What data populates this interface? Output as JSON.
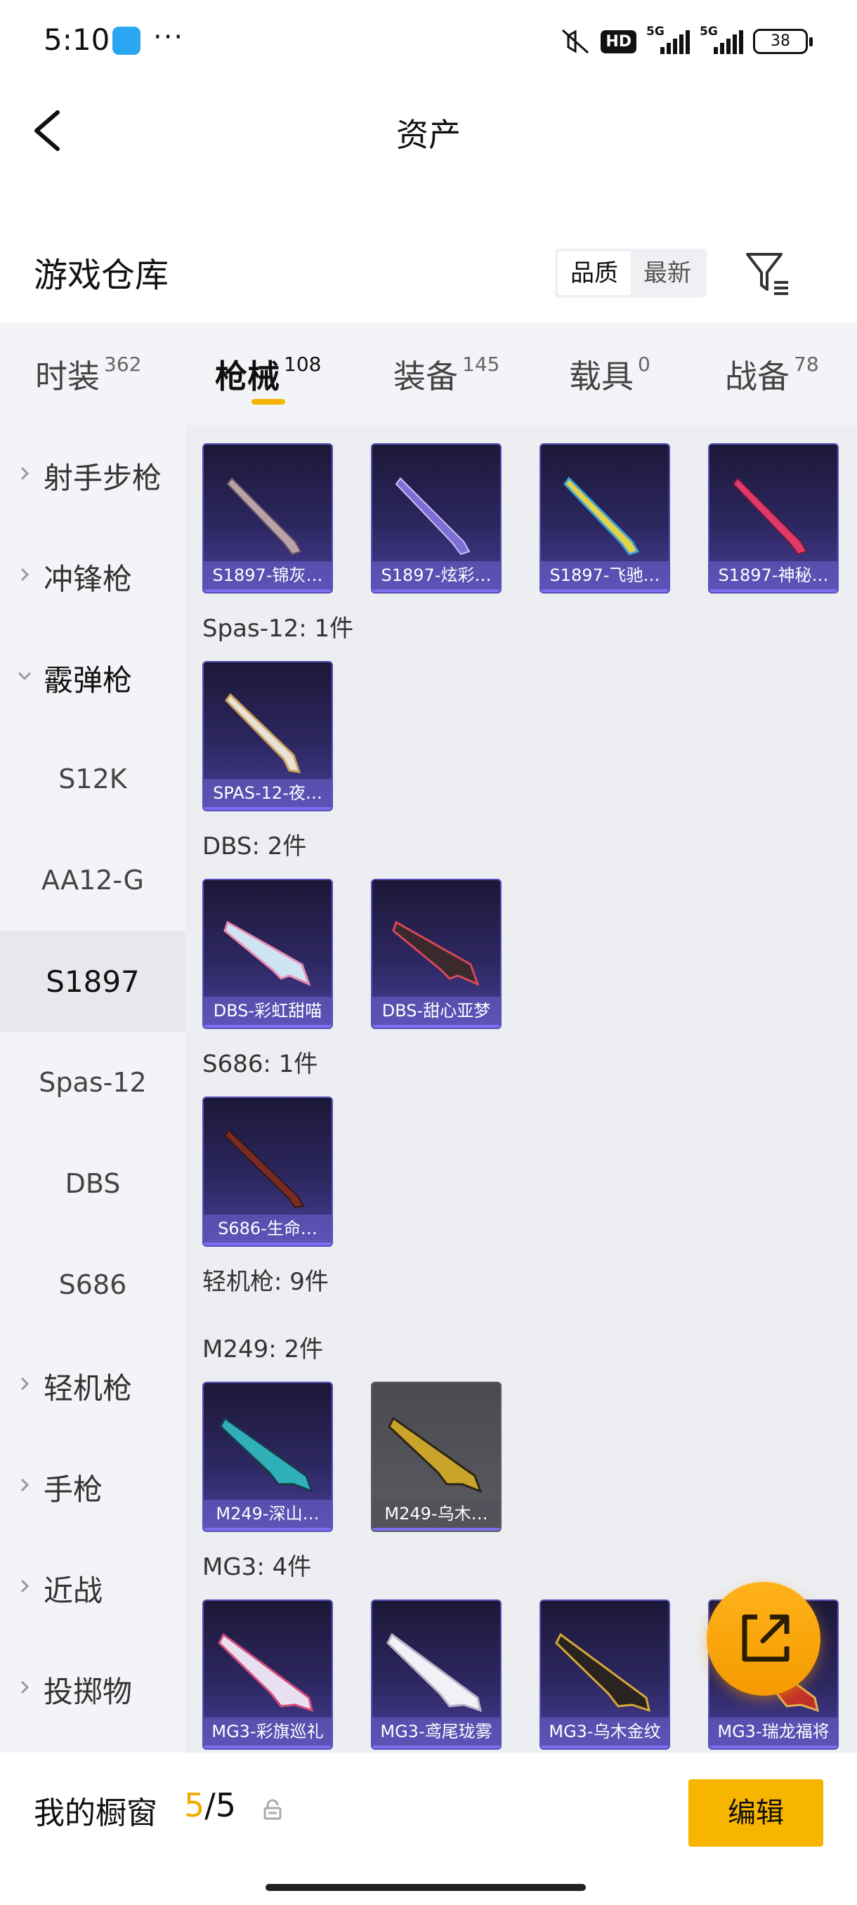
{
  "status_bar": {
    "time": "5:10",
    "more": "···",
    "hd": "HD",
    "net1": "5G",
    "net2": "5G",
    "battery": "38"
  },
  "header": {
    "title": "资产"
  },
  "section": {
    "title": "游戏仓库",
    "sort_quality": "品质",
    "sort_newest": "最新"
  },
  "tabs": [
    {
      "label": "时装",
      "count": "362"
    },
    {
      "label": "枪械",
      "count": "108",
      "active": true
    },
    {
      "label": "装备",
      "count": "145"
    },
    {
      "label": "载具",
      "count": "0"
    },
    {
      "label": "战备",
      "count": "78"
    }
  ],
  "sidebar": [
    {
      "label": "射手步枪",
      "type": "category"
    },
    {
      "label": "冲锋枪",
      "type": "category"
    },
    {
      "label": "霰弹枪",
      "type": "category",
      "open": true
    },
    {
      "label": "S12K",
      "type": "sub"
    },
    {
      "label": "AA12-G",
      "type": "sub"
    },
    {
      "label": "S1897",
      "type": "sub",
      "active": true
    },
    {
      "label": "Spas-12",
      "type": "sub"
    },
    {
      "label": "DBS",
      "type": "sub"
    },
    {
      "label": "S686",
      "type": "sub"
    },
    {
      "label": "轻机枪",
      "type": "category"
    },
    {
      "label": "手枪",
      "type": "category"
    },
    {
      "label": "近战",
      "type": "category"
    },
    {
      "label": "投掷物",
      "type": "category"
    }
  ],
  "groups": {
    "spas12": "Spas-12: 1件",
    "dbs": "DBS: 2件",
    "s686": "S686: 1件",
    "lmg": "轻机枪: 9件",
    "m249": "M249: 2件",
    "mg3": "MG3: 4件"
  },
  "items": {
    "s1897": [
      "S1897-锦灰…",
      "S1897-炫彩…",
      "S1897-飞驰…",
      "S1897-神秘…"
    ],
    "spas12": [
      "SPAS-12-夜…"
    ],
    "dbs": [
      "DBS-彩虹甜喵",
      "DBS-甜心亚梦"
    ],
    "s686": [
      "S686-生命…"
    ],
    "m249": [
      "M249-深山…",
      "M249-乌木…"
    ],
    "mg3": [
      "MG3-彩旗巡礼",
      "MG3-鸢尾珑雾",
      "MG3-乌木金纹",
      "MG3-瑞龙福将"
    ]
  },
  "bottom_bar": {
    "label": "我的橱窗",
    "current": "5",
    "sep": "/",
    "total": "5",
    "edit": "编辑"
  },
  "colors": {
    "accent": "#f7b500",
    "card": "#2d2760"
  }
}
